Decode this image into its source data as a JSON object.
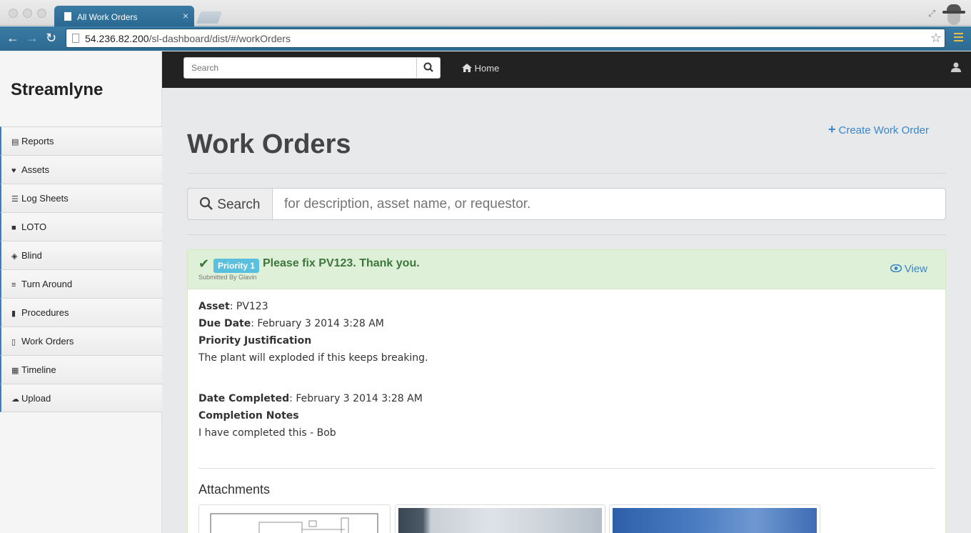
{
  "browser": {
    "tab_title": "All Work Orders",
    "url_host": "54.236.82.200",
    "url_path": "/sl-dashboard/dist/#/workOrders"
  },
  "sidebar": {
    "brand": "Streamlyne",
    "items": [
      {
        "label": "Reports",
        "icon": "list-alt-icon"
      },
      {
        "label": "Assets",
        "icon": "heart-icon"
      },
      {
        "label": "Log Sheets",
        "icon": "list-icon"
      },
      {
        "label": "LOTO",
        "icon": "lock-icon"
      },
      {
        "label": "Blind",
        "icon": "eye-slash-icon"
      },
      {
        "label": "Turn Around",
        "icon": "tasks-icon"
      },
      {
        "label": "Procedures",
        "icon": "book-icon"
      },
      {
        "label": "Work Orders",
        "icon": "file-icon"
      },
      {
        "label": "Timeline",
        "icon": "calendar-icon"
      },
      {
        "label": "Upload",
        "icon": "cloud-upload-icon"
      }
    ]
  },
  "topnav": {
    "search_placeholder": "Search",
    "home_label": "Home"
  },
  "main": {
    "title": "Work Orders",
    "create_label": "Create Work Order",
    "search_label": "Search",
    "search_placeholder": "for description, asset name, or requestor."
  },
  "work_order": {
    "priority": "Priority 1",
    "title": "Please fix PV123. Thank you.",
    "submitted_by": "Submitted By Glavin",
    "view_label": "View",
    "asset_label": "Asset",
    "asset_value": "PV123",
    "due_label": "Due Date",
    "due_value": "February 3 2014 3:28 AM",
    "justification_label": "Priority Justification",
    "justification_value": "The plant will exploded if this keeps breaking.",
    "completed_label": "Date Completed",
    "completed_value": "February 3 2014 3:28 AM",
    "notes_label": "Completion Notes",
    "notes_value": "I have completed this - Bob",
    "attachments_label": "Attachments"
  },
  "colors": {
    "accent": "#3a86c8",
    "success_bg": "#dff0d8",
    "success_text": "#3c763d",
    "badge": "#5bc0de",
    "navbar": "#222222"
  }
}
